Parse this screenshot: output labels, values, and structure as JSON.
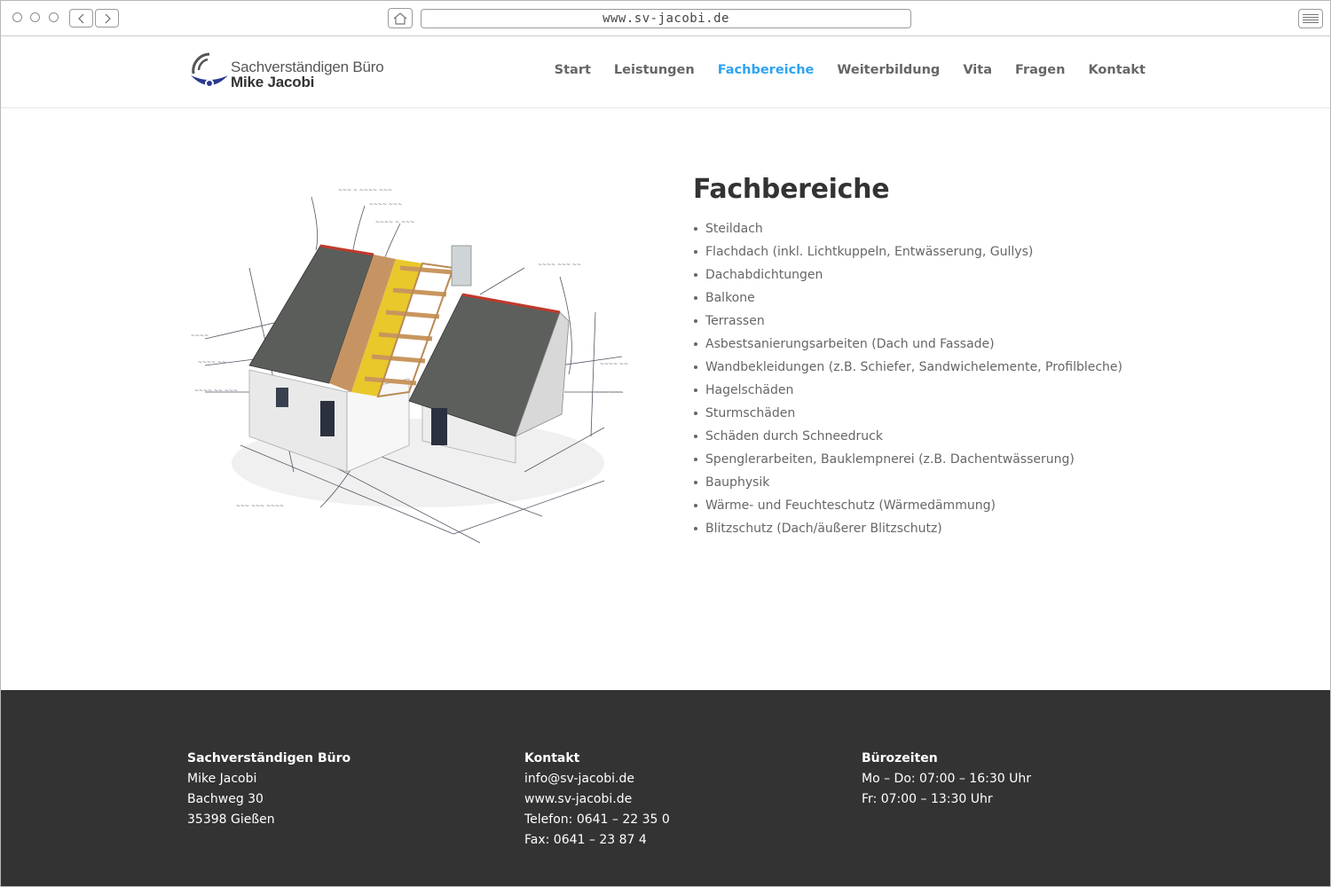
{
  "browser": {
    "url": "www.sv-jacobi.de"
  },
  "logo": {
    "line1": "Sachverständigen Büro",
    "line2": "Mike Jacobi"
  },
  "nav": {
    "items": [
      "Start",
      "Leistungen",
      "Fachbereiche",
      "Weiterbildung",
      "Vita",
      "Fragen",
      "Kontakt"
    ],
    "active": "Fachbereiche"
  },
  "colors": {
    "accent": "#2ea3f2",
    "footer_bg": "#333333",
    "logo_blue": "#2b3a8f"
  },
  "main": {
    "heading": "Fachbereiche",
    "image_icon": "house-sketch-illustration",
    "list": [
      "Steildach",
      "Flachdach (inkl. Lichtkuppeln, Entwässerung, Gullys)",
      "Dachabdichtungen",
      "Balkone",
      "Terrassen",
      "Asbestsanierungsarbeiten (Dach und Fassade)",
      "Wandbekleidungen (z.B. Schiefer, Sandwichelemente, Profilbleche)",
      "Hagelschäden",
      "Sturmschäden",
      "Schäden durch Schneedruck",
      "Spenglerarbeiten, Bauklempnerei (z.B. Dachentwässerung)",
      "Bauphysik",
      "Wärme- und Feuchteschutz (Wärmedämmung)",
      "Blitzschutz (Dach/äußerer Blitzschutz)"
    ]
  },
  "footer": {
    "col1": {
      "title": "Sachverständigen Büro",
      "lines": [
        "Mike Jacobi",
        "Bachweg 30",
        "35398 Gießen"
      ]
    },
    "col2": {
      "title": "Kontakt",
      "lines": [
        "info@sv-jacobi.de",
        "www.sv-jacobi.de",
        "Telefon: 0641 – 22 35 0",
        "Fax: 0641 – 23 87 4"
      ]
    },
    "col3": {
      "title": "Bürozeiten",
      "lines": [
        "Mo – Do: 07:00 – 16:30 Uhr",
        "Fr: 07:00 – 13:30 Uhr"
      ]
    }
  }
}
